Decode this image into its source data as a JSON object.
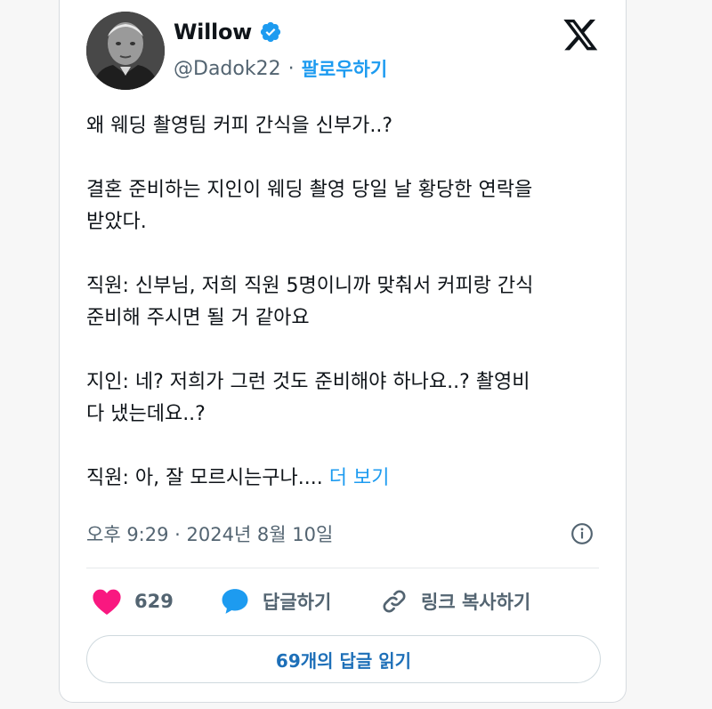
{
  "author": {
    "display_name": "Willow",
    "handle": "@Dadok22",
    "separator": "·",
    "follow_label": "팔로우하기",
    "verified": true
  },
  "tweet": {
    "paragraphs": [
      "왜 웨딩 촬영팀 커피 간식을 신부가..?",
      "결혼 준비하는 지인이 웨딩 촬영 당일 날 황당한 연락을\n받았다.",
      "직원: 신부님, 저희 직원 5명이니까 맞춰서 커피랑 간식\n준비해 주시면 될 거 같아요",
      "지인: 네? 저희가 그런 것도 준비해야 하나요..? 촬영비\n다 냈는데요..?"
    ],
    "last_paragraph": "직원: 아, 잘 모르시는구나.... ",
    "more_label": "더 보기",
    "timestamp": "오후 9:29 · 2024년 8월 10일"
  },
  "actions": {
    "like_count": "629",
    "reply_label": "답글하기",
    "copy_link_label": "링크 복사하기"
  },
  "read_replies_label": "69개의 답글 읽기",
  "colors": {
    "accent": "#1d9bf0",
    "like": "#f91880",
    "reply": "#1d9bf0",
    "text": "#0f1419",
    "muted": "#536471"
  },
  "icons": {
    "verified": "verified-badge-icon",
    "logo": "x-logo-icon",
    "info": "info-icon",
    "like": "heart-icon",
    "reply": "speech-bubble-icon",
    "copy": "link-icon"
  }
}
